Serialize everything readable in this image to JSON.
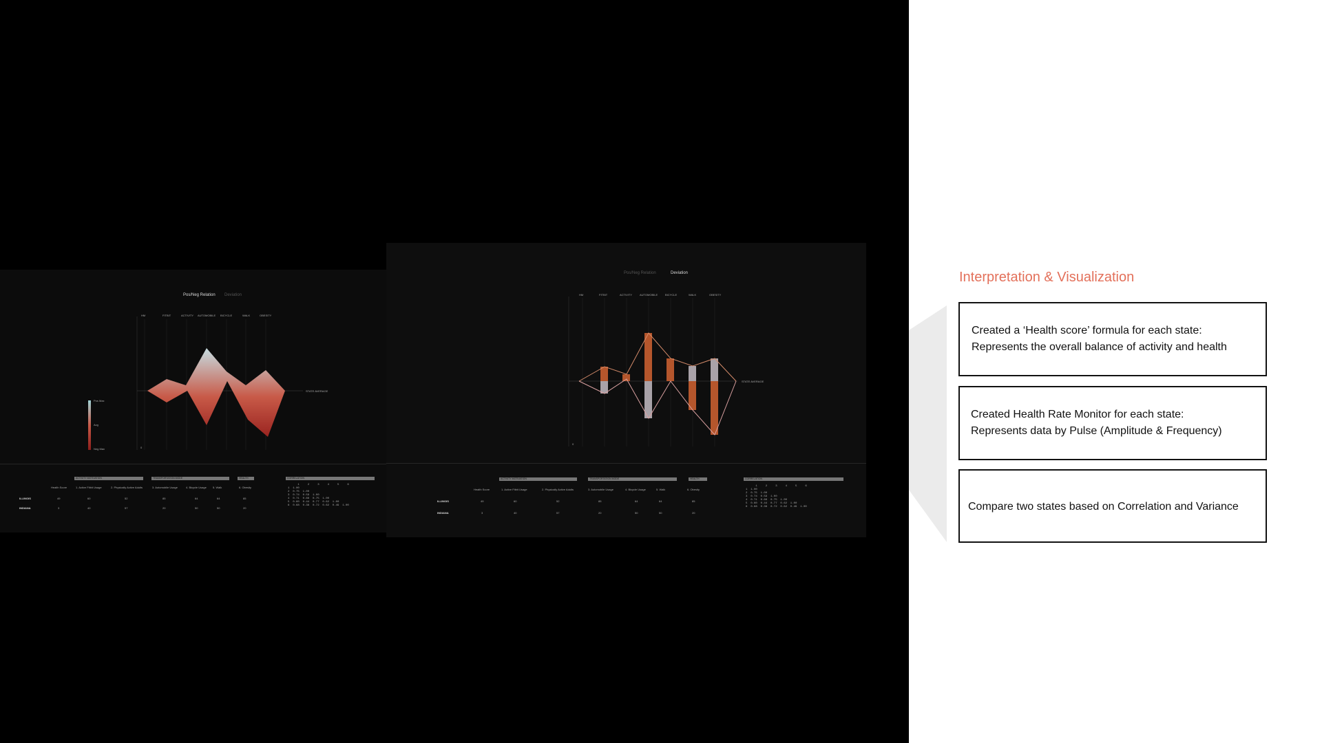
{
  "left": {
    "panel1": {
      "tabs": [
        "Pos/Neg Relation",
        "Deviation"
      ],
      "active_tab": 0,
      "axis_labels": [
        "HM",
        "FITBIT",
        "ACTIVITY",
        "AUTOMOBILE",
        "BICYCLE",
        "WALK",
        "OBESITY"
      ],
      "state_average": "STATE AVERAGE",
      "legend": [
        "Pos Max",
        "Avg",
        "Neg Max"
      ],
      "zero": "0"
    },
    "panel2": {
      "tabs": [
        "Pos/Neg Relation",
        "Deviation"
      ],
      "active_tab": 1,
      "axis_labels": [
        "HM",
        "FITBIT",
        "ACTIVITY",
        "AUTOMOBILE",
        "BICYCLE",
        "WALK",
        "OBESITY"
      ],
      "state_average": "STATE AVERAGE",
      "zero": "0"
    },
    "table": {
      "groups": [
        "ACTIVITY MOTIVATION",
        "TRANSPORTATION MODE",
        "HEALTH",
        "CORRELATION"
      ],
      "columns": [
        "Health Score",
        "1. Active Fitbit Usage",
        "2. Physically Active Adults",
        "3. Automobile Usage",
        "4. Bicycle Usage",
        "5. Walk",
        "6. Obesity"
      ],
      "rows": [
        {
          "state": "ILLINOIS",
          "values": [
            "49",
            "60",
            "52",
            "85",
            "64",
            "64",
            "85"
          ]
        },
        {
          "state": "INDIANA",
          "values": [
            "3",
            "40",
            "57",
            "20",
            "50",
            "50",
            "20"
          ]
        }
      ],
      "correlation": {
        "headers": [
          "1",
          "2",
          "3",
          "4",
          "5",
          "6"
        ],
        "rows": [
          [
            "1",
            "1.00"
          ],
          [
            "2",
            "0.75",
            "1.00"
          ],
          [
            "3",
            "0.74",
            "0.59",
            "1.00"
          ],
          [
            "4",
            "0.71",
            "0.66",
            "0.75",
            "1.00"
          ],
          [
            "5",
            "0.60",
            "0.44",
            "0.77",
            "0.62",
            "1.00"
          ],
          [
            "6",
            "0.68",
            "0.38",
            "0.72",
            "0.62",
            "0.49",
            "1.00"
          ]
        ]
      }
    }
  },
  "right": {
    "title": "Interpretation & Visualization",
    "title_color": "#e3705a",
    "cards": [
      {
        "lines": [
          "Created a ‘Health score’ formula for each state:",
          "Represents the overall balance of activity and health"
        ]
      },
      {
        "lines": [
          "Created Health Rate Monitor for each state:",
          "Represents data by Pulse (Amplitude & Frequency)"
        ]
      },
      {
        "lines": [
          "Compare two states based on Correlation and Variance"
        ]
      }
    ]
  }
}
